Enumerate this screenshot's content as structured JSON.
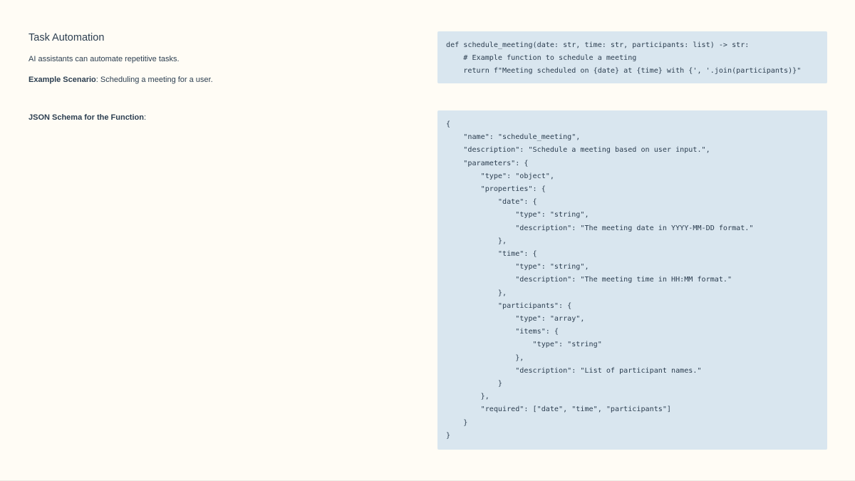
{
  "slide": {
    "title": "Task Automation",
    "intro": "AI assistants can automate repetitive tasks.",
    "scenario_label": "Example Scenario",
    "scenario_text": ": Scheduling a meeting for a user.",
    "schema_label": "JSON Schema for the Function",
    "schema_colon": ":"
  },
  "code": {
    "python": "def schedule_meeting(date: str, time: str, participants: list) -> str:\n    # Example function to schedule a meeting\n    return f\"Meeting scheduled on {date} at {time} with {', '.join(participants)}\"",
    "json": "{\n    \"name\": \"schedule_meeting\",\n    \"description\": \"Schedule a meeting based on user input.\",\n    \"parameters\": {\n        \"type\": \"object\",\n        \"properties\": {\n            \"date\": {\n                \"type\": \"string\",\n                \"description\": \"The meeting date in YYYY-MM-DD format.\"\n            },\n            \"time\": {\n                \"type\": \"string\",\n                \"description\": \"The meeting time in HH:MM format.\"\n            },\n            \"participants\": {\n                \"type\": \"array\",\n                \"items\": {\n                    \"type\": \"string\"\n                },\n                \"description\": \"List of participant names.\"\n            }\n        },\n        \"required\": [\"date\", \"time\", \"participants\"]\n    }\n}"
  },
  "colors": {
    "background": "#fffcf5",
    "text": "#2c3e50",
    "code_background": "#d9e6ef"
  }
}
